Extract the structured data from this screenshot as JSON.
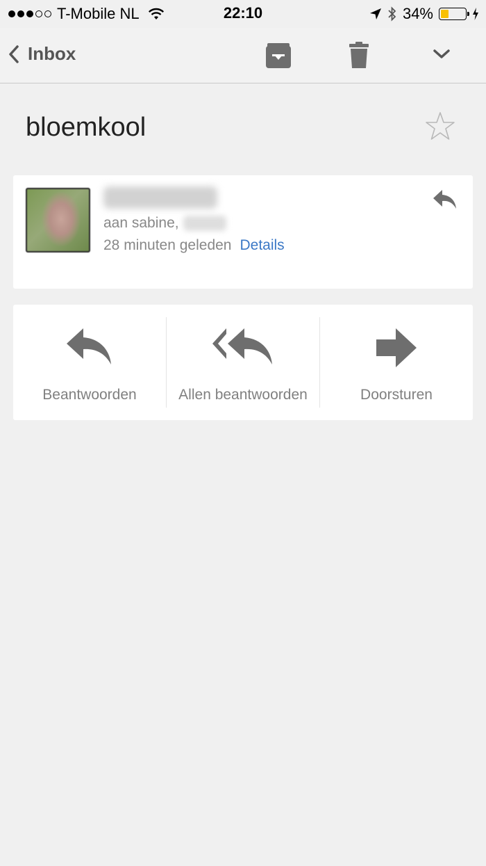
{
  "status_bar": {
    "carrier": "T-Mobile NL",
    "time": "22:10",
    "battery_percent": "34%",
    "battery_level": 0.34,
    "signal_bars_filled": 3,
    "signal_bars_total": 5
  },
  "nav": {
    "back_label": "Inbox",
    "icons": [
      "back-chevron-icon",
      "archive-icon",
      "trash-icon",
      "chevron-down-icon"
    ]
  },
  "email": {
    "subject": "bloemkool",
    "to_prefix": "aan sabine,",
    "received": "28 minuten geleden",
    "details_label": "Details"
  },
  "actions": {
    "reply": "Beantwoorden",
    "reply_all": "Allen beantwoorden",
    "forward": "Doorsturen"
  },
  "colors": {
    "background": "#f0f0f0",
    "card": "#ffffff",
    "link": "#3b78c6",
    "icon_gray": "#6e6e6e",
    "battery_yellow": "#f8c000"
  }
}
